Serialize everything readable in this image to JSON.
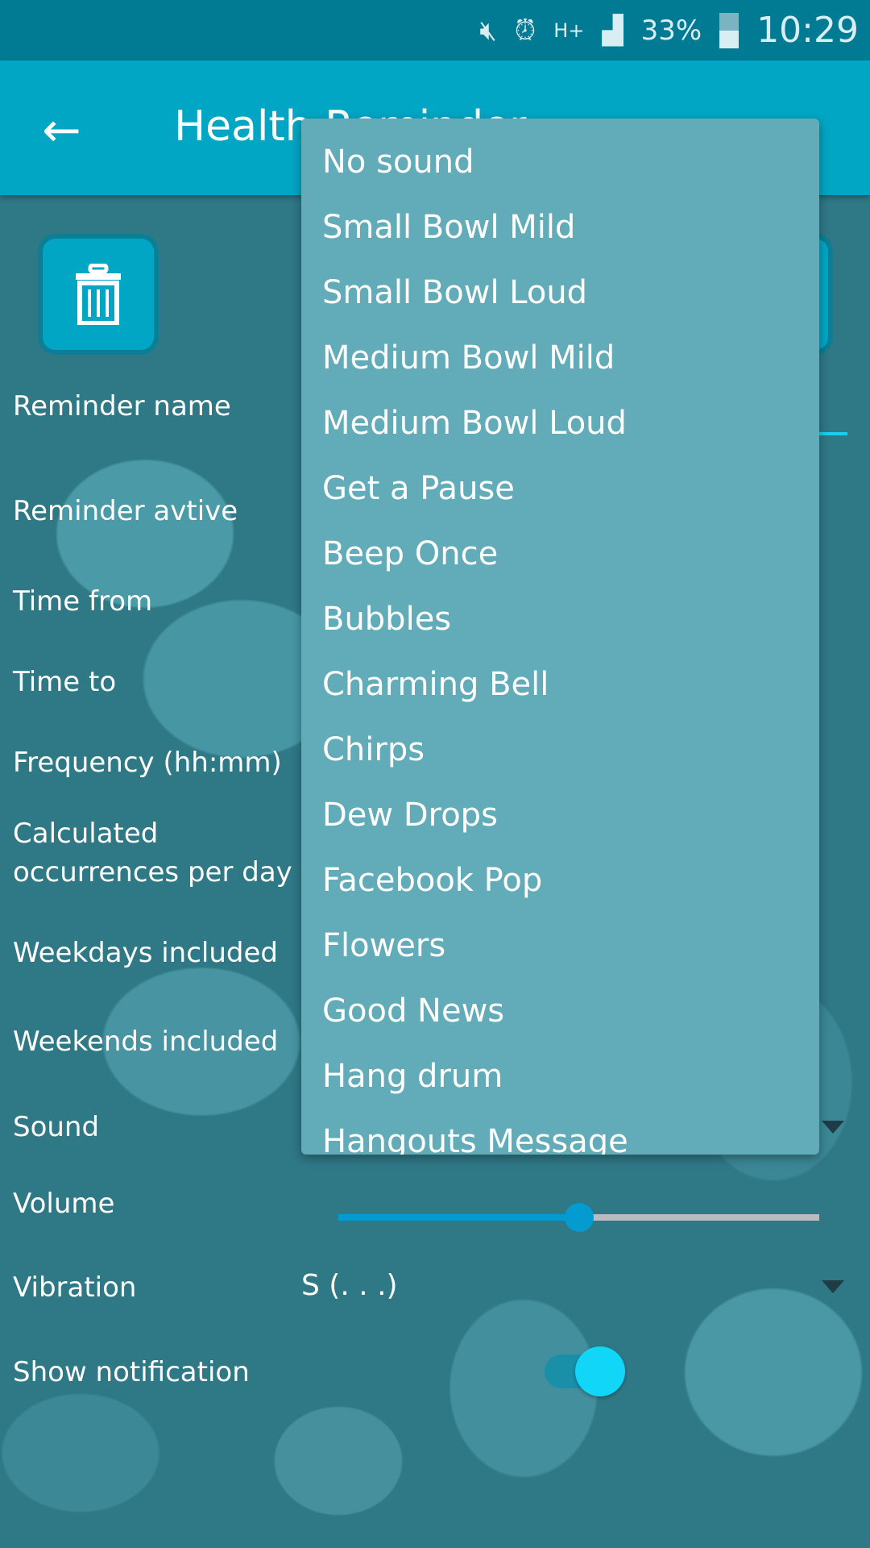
{
  "status_bar": {
    "battery": "33%",
    "time": "10:29",
    "network": "H+",
    "icons": [
      "mute-icon",
      "alarm-icon",
      "network-h-plus-icon",
      "signal-icon",
      "battery-icon"
    ]
  },
  "app_bar": {
    "title": "Health Reminder",
    "back_icon": "arrow-left-icon"
  },
  "form": {
    "labels": {
      "name": "Reminder name",
      "active": "Reminder avtive",
      "time_from": "Time from",
      "time_to": "Time to",
      "frequency": "Frequency (hh:mm)",
      "occurrences": "Calculated occurrences per day",
      "weekdays": "Weekdays included",
      "weekends": "Weekends included",
      "sound": "Sound",
      "volume": "Volume",
      "vibration": "Vibration",
      "show_notification": "Show notification"
    },
    "vibration_value": "S (. . .)",
    "volume_percent": 50,
    "show_notification": true
  },
  "sound_dropdown": {
    "options": [
      "No sound",
      "Small Bowl Mild",
      "Small Bowl Loud",
      "Medium Bowl Mild",
      "Medium Bowl Loud",
      "Get a Pause",
      "Beep Once",
      "Bubbles",
      "Charming Bell",
      "Chirps",
      "Dew Drops",
      "Facebook Pop",
      "Flowers",
      "Good News",
      "Hang drum",
      "Hangouts Message"
    ]
  },
  "colors": {
    "status_bar": "#017a93",
    "app_bar": "#00a6c4",
    "dropdown": "#62abb8",
    "accent": "#039bd0",
    "toggle": "#12d6f7"
  }
}
